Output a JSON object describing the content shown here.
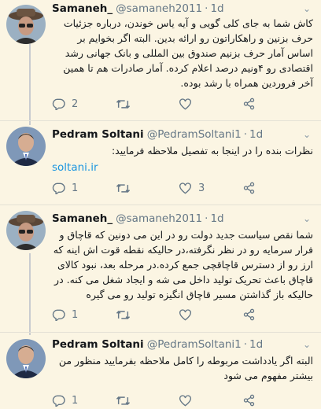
{
  "tweets": [
    {
      "name": "Samaneh_",
      "handle": "@samaneh2011",
      "time": "1d",
      "text": "کاش شما به جای کلی گویی و آیه یاس خوندن، درباره جزئیات حرف بزنین و راهکاراتون رو ارائه بدین. البته اگر بخوایم بر اساس آمار حرف بزنیم صندوق بین المللی و بانک جهانی رشد اقتصادی رو ۴ونیم درصد اعلام کرده. آمار صادرات هم تا همین آخر فروردین همراه با رشد بوده.",
      "replies": "2",
      "retweets": "",
      "likes": ""
    },
    {
      "name": "Pedram Soltani",
      "handle": "@PedramSoltani1",
      "time": "1d",
      "text": "نظرات بنده را در اینجا به تفصیل ملاحظه فرمایید:",
      "link": "soltani.ir",
      "replies": "1",
      "retweets": "",
      "likes": "3"
    },
    {
      "name": "Samaneh_",
      "handle": "@samaneh2011",
      "time": "1d",
      "text": "شما نقص سیاست جدید دولت رو در این می دونین که قاچاق و فرار سرمایه رو در نظر نگرفته،در حالیکه نقطه قوت اش اینه که ارز رو از دسترس قاچاقچی جمع کرده.در مرحله بعد، نبود کالای قاچاق باعث تحریک تولید داخل می شه و ایجاد شغل می کنه. در حالیکه باز گذاشتن مسیر قاچاق انگیزه تولید رو می گیره",
      "replies": "1",
      "retweets": "",
      "likes": ""
    },
    {
      "name": "Pedram Soltani",
      "handle": "@PedramSoltani1",
      "time": "1d",
      "text": "البته اگر یادداشت مربوطه را کامل ملاحظه بفرمایید منظور من بیشتر مفهوم می شود",
      "replies": "1",
      "retweets": "",
      "likes": ""
    }
  ],
  "colors": {
    "background": "#fbf5e3",
    "link": "#1b95e0",
    "muted": "#657786",
    "thread_line": "#c9ccd0"
  },
  "icons": {
    "reply": "reply-icon",
    "retweet": "retweet-icon",
    "like": "heart-icon",
    "share": "share-icon",
    "more": "chevron-down-icon"
  }
}
